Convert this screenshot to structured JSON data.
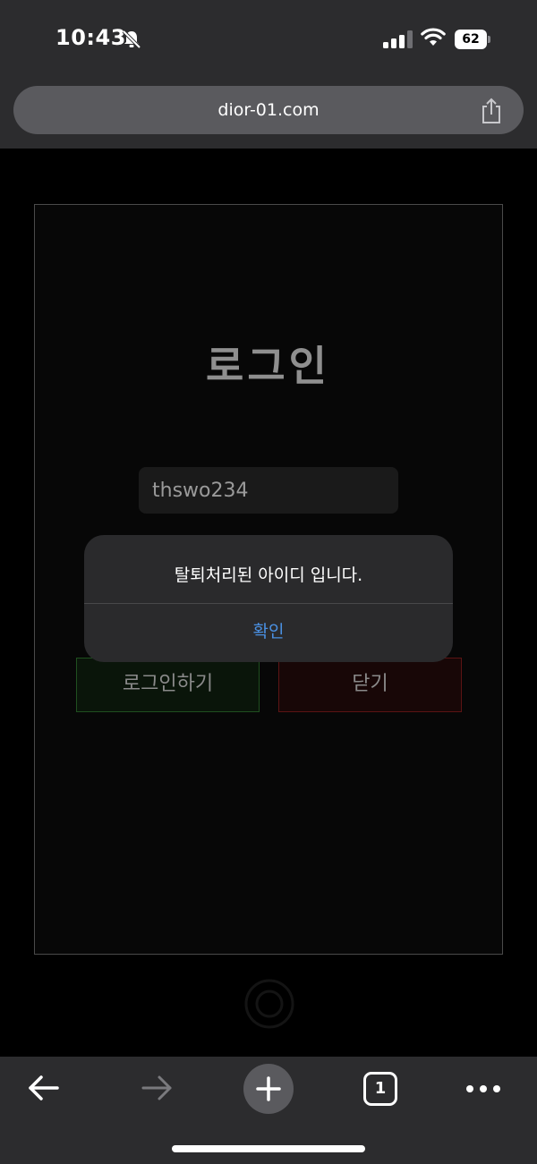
{
  "status_bar": {
    "time": "10:43",
    "battery_level": "62",
    "icons": [
      "bell-slash-icon",
      "signal-icon",
      "wifi-icon",
      "battery-icon"
    ]
  },
  "browser": {
    "url": "dior-01.com",
    "tab_count": "1",
    "icons": [
      "share-icon",
      "back-arrow-icon",
      "forward-arrow-icon",
      "plus-icon",
      "more-icon"
    ]
  },
  "login": {
    "title": "로그인",
    "id_value": "thswo234",
    "login_button": "로그인하기",
    "close_button": "닫기"
  },
  "alert": {
    "message": "탈퇴처리된 아이디 입니다.",
    "ok_label": "확인"
  },
  "colors": {
    "chrome_bg": "#2c2c2e",
    "alert_link": "#4a90e2",
    "login_border": "#1f4f1f",
    "close_border": "#5c1414"
  }
}
